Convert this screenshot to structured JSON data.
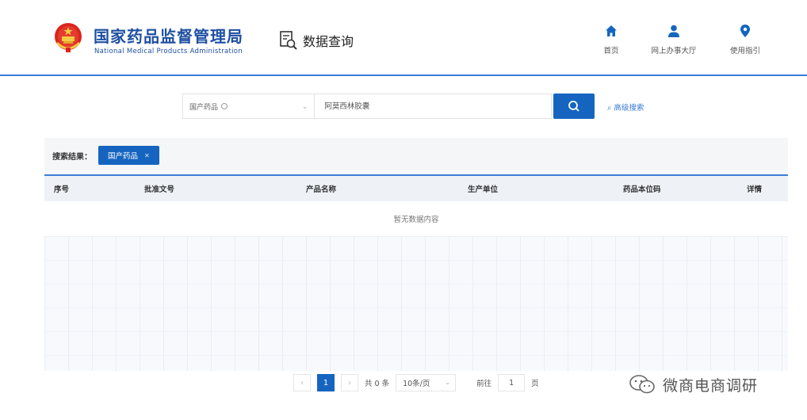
{
  "header": {
    "brand_cn": "国家药品监督管理局",
    "brand_en": "National Medical Products Administration",
    "query_label": "数据查询",
    "nav": [
      {
        "label": "首页",
        "icon": "home-icon"
      },
      {
        "label": "网上办事大厅",
        "icon": "user-icon"
      },
      {
        "label": "使用指引",
        "icon": "location-icon"
      }
    ]
  },
  "search": {
    "type_selected": "国产药品",
    "keyword_placeholder": "阿莫西林胶囊",
    "advanced_label": "高级搜索"
  },
  "results": {
    "label": "搜索结果：",
    "active_tag": "国产药品"
  },
  "table": {
    "columns": [
      "序号",
      "批准文号",
      "产品名称",
      "生产单位",
      "药品本位码",
      "详情"
    ],
    "empty_text": "暂无数据内容"
  },
  "pagination": {
    "prev": "‹",
    "next": "›",
    "current_page": "1",
    "total": "共 0 条",
    "page_size": "10条/页",
    "goto_label": "前往",
    "goto_value": "1",
    "page_unit": "页"
  },
  "watermark": {
    "text": "微商电商调研"
  },
  "colors": {
    "primary": "#1565c0",
    "brand_text": "#1e4fa3",
    "accent_line": "#3a7bd5"
  }
}
